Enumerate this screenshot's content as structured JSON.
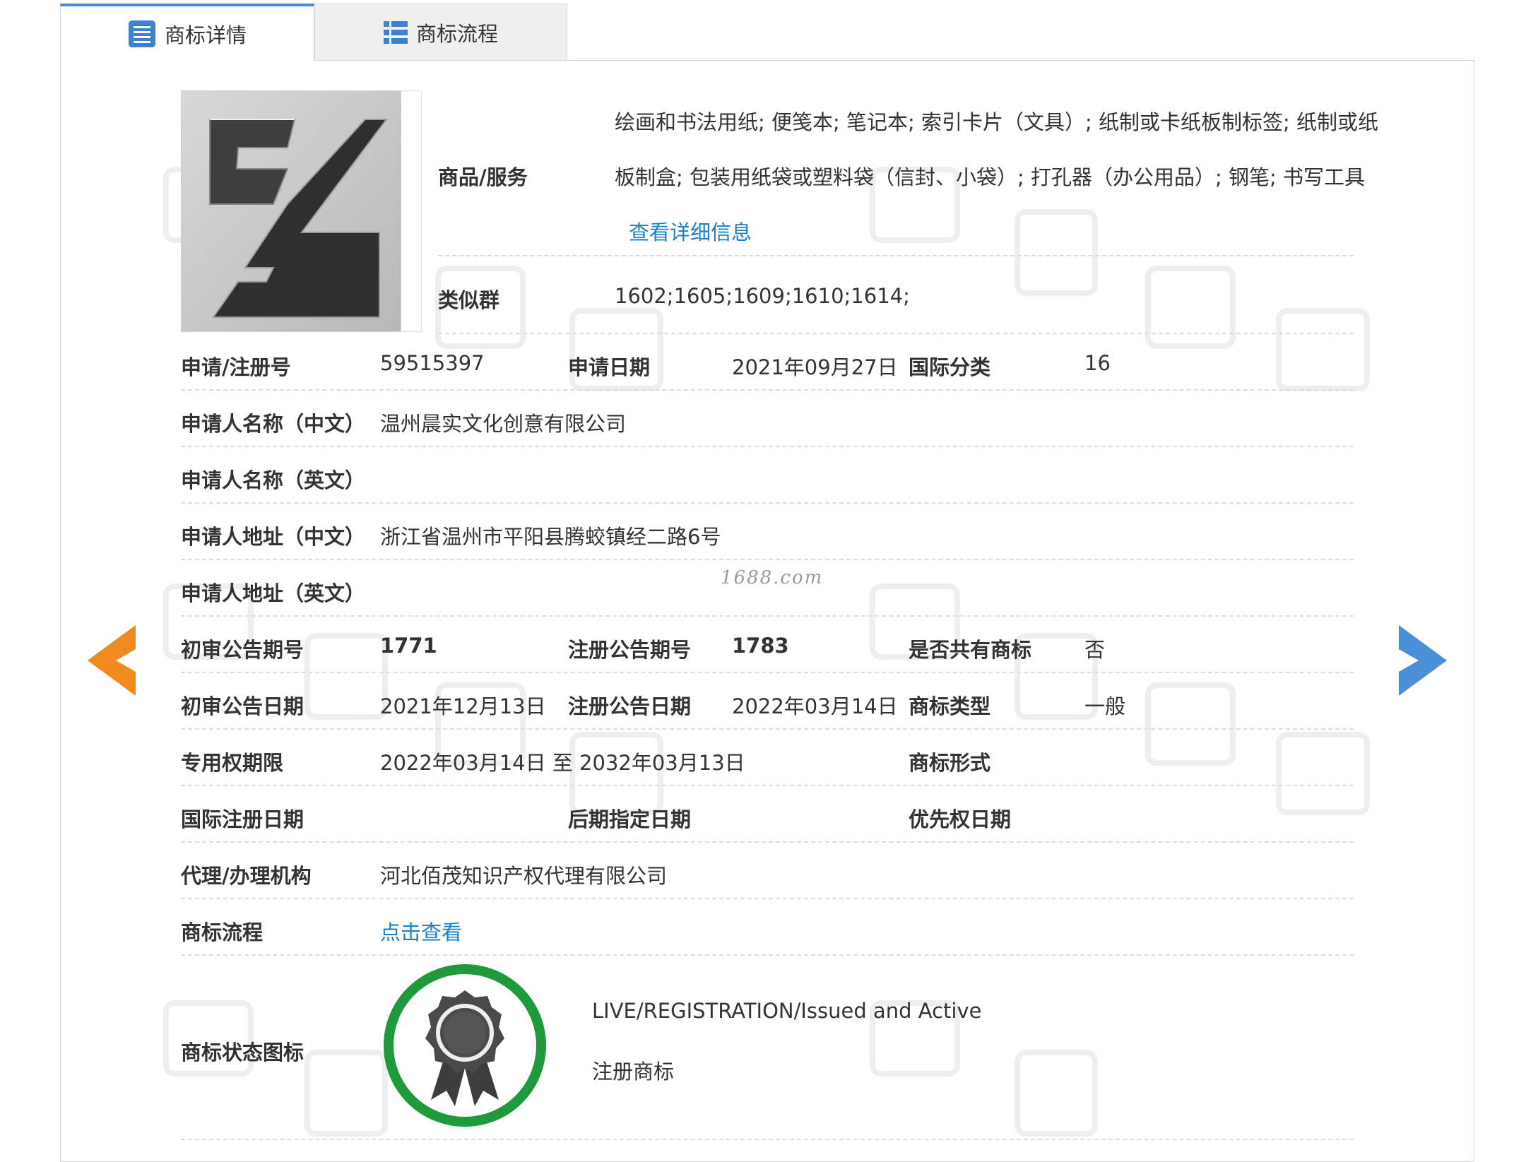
{
  "tabs": [
    {
      "label": "商标详情",
      "icon": "list-doc-icon",
      "active": true
    },
    {
      "label": "商标流程",
      "icon": "list-grid-icon",
      "active": false
    }
  ],
  "goods": {
    "label": "商品/服务",
    "line1": "绘画和书法用纸; 便笺本; 笔记本; 索引卡片（文具）; 纸制或卡纸板制标签; 纸制或纸",
    "line2": "板制盒; 包装用纸袋或塑料袋（信封、小袋）; 打孔器（办公用品）; 钢笔; 书写工具",
    "detail_link": "查看详细信息"
  },
  "similar": {
    "label": "类似群",
    "value": "1602;1605;1609;1610;1614;"
  },
  "reg": {
    "no_label": "申请/注册号",
    "no_value": "59515397",
    "date_label": "申请日期",
    "date_value": "2021年09月27日",
    "class_label": "国际分类",
    "class_value": "16"
  },
  "applicant": {
    "name_cn_label": "申请人名称（中文）",
    "name_cn_value": "温州晨实文化创意有限公司",
    "name_en_label": "申请人名称（英文）",
    "name_en_value": "",
    "addr_cn_label": "申请人地址（中文）",
    "addr_cn_value": "浙江省温州市平阳县腾蛟镇经二路6号",
    "addr_en_label": "申请人地址（英文）",
    "addr_en_value": ""
  },
  "watermark_text": "1688.com",
  "publication": {
    "prelim_no_label": "初审公告期号",
    "prelim_no_value": "1771",
    "reg_no_label": "注册公告期号",
    "reg_no_value": "1783",
    "shared_label": "是否共有商标",
    "shared_value": "否",
    "prelim_date_label": "初审公告日期",
    "prelim_date_value": "2021年12月13日",
    "reg_date_label": "注册公告日期",
    "reg_date_value": "2022年03月14日",
    "type_label": "商标类型",
    "type_value": "一般"
  },
  "rights": {
    "period_label": "专用权期限",
    "period_value": "2022年03月14日 至 2032年03月13日",
    "form_label": "商标形式",
    "form_value": ""
  },
  "dates": {
    "intl_label": "国际注册日期",
    "intl_value": "",
    "later_label": "后期指定日期",
    "later_value": "",
    "priority_label": "优先权日期",
    "priority_value": ""
  },
  "agent": {
    "label": "代理/办理机构",
    "value": "河北佰茂知识产权代理有限公司"
  },
  "flow": {
    "label": "商标流程",
    "link": "点击查看"
  },
  "status": {
    "label": "商标状态图标",
    "line1": "LIVE/REGISTRATION/Issued and Active",
    "line2": "注册商标",
    "icon": "award-badge-icon",
    "ring_color": "#1e9a3c"
  },
  "colors": {
    "accent": "#4a88d6",
    "link": "#1a7fc4",
    "prev_arrow": "#f08a1c",
    "next_arrow": "#4a90d9"
  },
  "nav": {
    "prev_icon": "arrow-left-icon",
    "next_icon": "arrow-right-icon"
  }
}
